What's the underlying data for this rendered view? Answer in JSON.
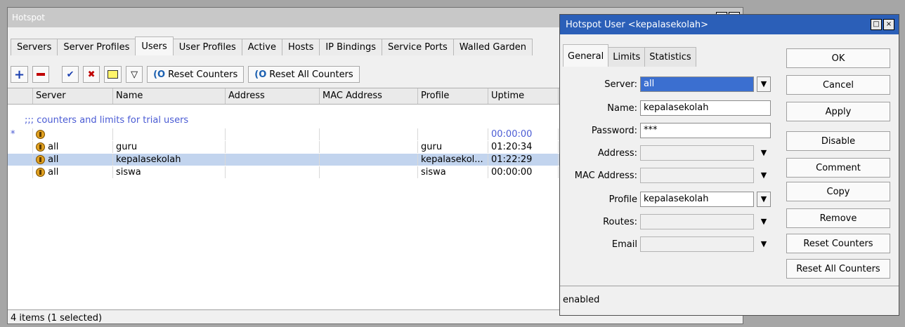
{
  "main": {
    "title": "Hotspot",
    "tabs": [
      "Servers",
      "Server Profiles",
      "Users",
      "User Profiles",
      "Active",
      "Hosts",
      "IP Bindings",
      "Service Ports",
      "Walled Garden"
    ],
    "toolbar": {
      "reset_counters": "Reset Counters",
      "reset_all_counters": "Reset All Counters"
    },
    "columns": [
      "Server",
      "Name",
      "Address",
      "MAC Address",
      "Profile",
      "Uptime"
    ],
    "comment": ";;; counters and limits for trial users",
    "rows": [
      {
        "marker": "*",
        "server": "",
        "name": "",
        "address": "",
        "mac": "",
        "profile": "",
        "uptime": "00:00:00"
      },
      {
        "marker": "",
        "server": "all",
        "name": "guru",
        "address": "",
        "mac": "",
        "profile": "guru",
        "uptime": "01:20:34"
      },
      {
        "marker": "",
        "server": "all",
        "name": "kepalasekolah",
        "address": "",
        "mac": "",
        "profile": "kepalasekol...",
        "uptime": "01:22:29"
      },
      {
        "marker": "",
        "server": "all",
        "name": "siswa",
        "address": "",
        "mac": "",
        "profile": "siswa",
        "uptime": "00:00:00"
      }
    ],
    "status": "4 items (1 selected)"
  },
  "dialog": {
    "title": "Hotspot User <kepalasekolah>",
    "tabs": [
      "General",
      "Limits",
      "Statistics"
    ],
    "fields": {
      "server_label": "Server:",
      "server_value": "all",
      "name_label": "Name:",
      "name_value": "kepalasekolah",
      "password_label": "Password:",
      "password_value": "***",
      "address_label": "Address:",
      "address_value": "",
      "mac_label": "MAC Address:",
      "mac_value": "",
      "profile_label": "Profile",
      "profile_value": "kepalasekolah",
      "routes_label": "Routes:",
      "routes_value": "",
      "email_label": "Email",
      "email_value": ""
    },
    "buttons": [
      "OK",
      "Cancel",
      "Apply",
      "Disable",
      "Comment",
      "Copy",
      "Remove",
      "Reset Counters",
      "Reset All Counters"
    ],
    "status": "enabled"
  },
  "colors": {
    "title_active": "#2b5fb8",
    "selection": "#c2d4ee",
    "comment": "#4a5bd4"
  }
}
